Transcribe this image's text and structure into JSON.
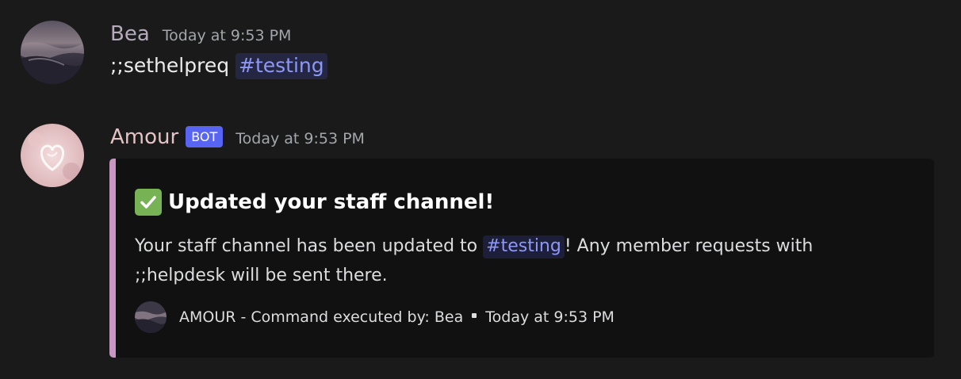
{
  "messages": [
    {
      "username": "Bea",
      "username_color": "#b4aabb",
      "timestamp": "Today at 9:53 PM",
      "content_prefix": ";;sethelpreq",
      "content_mention": "#testing"
    },
    {
      "username": "Amour",
      "username_color": "#e3c3c3",
      "bot_tag": "BOT",
      "timestamp": "Today at 9:53 PM",
      "embed": {
        "bar_color": "#c896c2",
        "title_icon": "white-check-mark-icon",
        "title": "Updated your staff channel!",
        "description_prefix": "Your staff channel has been updated to",
        "description_mention": "#testing",
        "description_suffix": "! Any member requests with",
        "description_line2": ";;helpdesk will be sent there.",
        "footer_text": "AMOUR - Command executed by: Bea",
        "footer_timestamp": "Today at 9:53 PM"
      }
    }
  ],
  "colors": {
    "background": "#1a1a1b",
    "embed_background": "#111112",
    "mention_text": "#8d98f6",
    "bot_tag": "#5865f2",
    "check_green": "#77b255"
  }
}
